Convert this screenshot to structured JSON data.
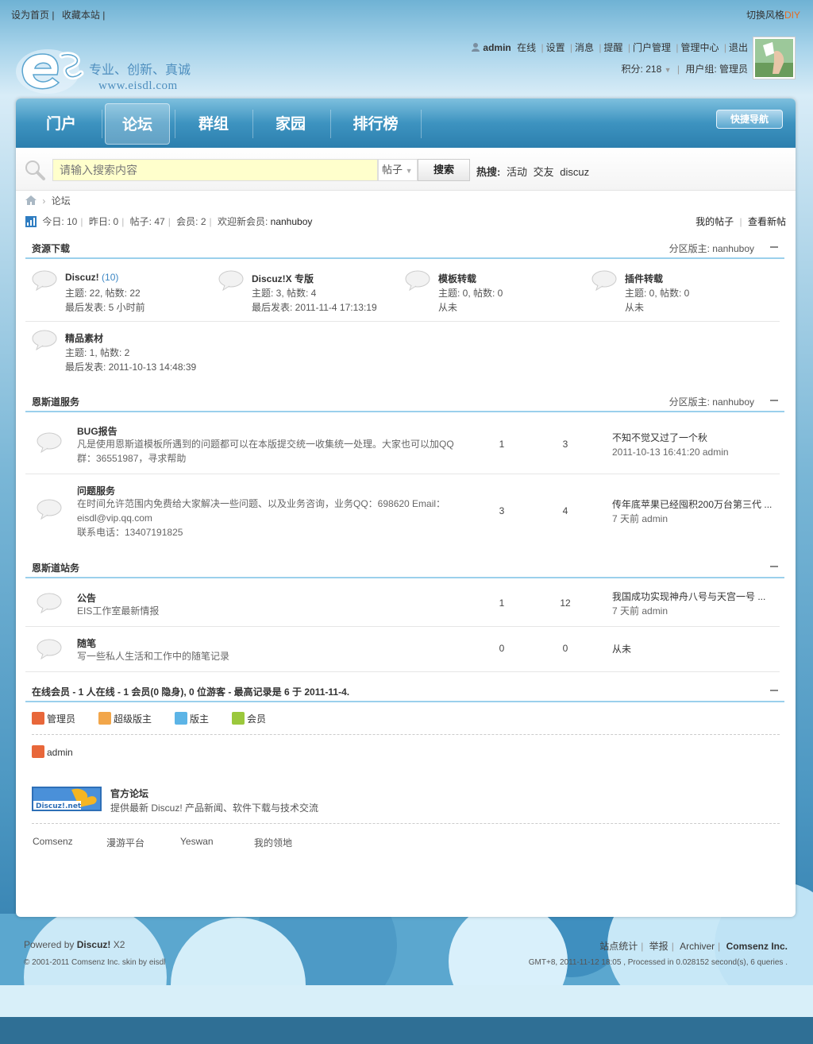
{
  "topbar": {
    "set_home": "设为首页",
    "bookmark": "收藏本站",
    "sep": "|",
    "switch_style": "切换风格",
    "diy": "DIY"
  },
  "header": {
    "slogan": "专业、创新、真诚",
    "url": "www.eisdl.com",
    "user": {
      "name": "admin",
      "status": "在线",
      "links": [
        "设置",
        "消息",
        "提醒",
        "门户管理",
        "管理中心",
        "退出"
      ]
    },
    "credits_label": "积分: 218",
    "usergroup_label": "用户组: 管理员"
  },
  "nav": {
    "items": [
      "门户",
      "论坛",
      "群组",
      "家园",
      "排行榜"
    ],
    "active": "论坛",
    "quick_nav": "快捷导航"
  },
  "search": {
    "placeholder": "请输入搜索内容",
    "type": "帖子",
    "button": "搜索",
    "hot_label": "热搜:",
    "hot_terms": [
      "活动",
      "交友",
      "discuz"
    ]
  },
  "breadcrumb": {
    "current": "论坛"
  },
  "stats": {
    "today": "今日: 10",
    "yesterday": "昨日: 0",
    "posts": "帖子: 47",
    "members": "会员: 2",
    "welcome": "欢迎新会员:",
    "newest": "nanhuboy",
    "my_posts": "我的帖子",
    "new_posts": "查看新帖"
  },
  "sections": [
    {
      "title": "资源下载",
      "moderator_label": "分区版主:",
      "moderator": "nanhuboy",
      "forums": [
        {
          "name": "Discuz!",
          "count": "(10)",
          "line1": "主题: 22, 帖数: 22",
          "line2": "最后发表: 5 小时前"
        },
        {
          "name": "Discuz!X 专版",
          "line1": "主题: 3, 帖数: 4",
          "line2": "最后发表: 2011-11-4 17:13:19"
        },
        {
          "name": "模板转载",
          "line1": "主题: 0, 帖数: 0",
          "line2": "从未"
        },
        {
          "name": "插件转载",
          "line1": "主题: 0, 帖数: 0",
          "line2": "从未"
        },
        {
          "name": "精品素材",
          "line1": "主题: 1, 帖数: 2",
          "line2": "最后发表: 2011-10-13 14:48:39"
        }
      ]
    },
    {
      "title": "恩斯道服务",
      "moderator_label": "分区版主:",
      "moderator": "nanhuboy",
      "forums": [
        {
          "name": "BUG报告",
          "desc1": "凡是使用恩斯道模板所遇到的问题都可以在本版提交统一收集统一处理。大家也可以加QQ",
          "desc2": "群：36551987，寻求帮助",
          "threads": "1",
          "posts": "3",
          "last_title": "不知不觉又过了一个秋",
          "last_meta": "2011-10-13 16:41:20 admin"
        },
        {
          "name": "问题服务",
          "desc1": "在时间允许范围内免费给大家解决一些问题、以及业务咨询，业务QQ：698620 Email：",
          "desc2": "eisdl@vip.qq.com",
          "desc3": "联系电话：13407191825",
          "threads": "3",
          "posts": "4",
          "last_title": "传年底苹果已经囤积200万台第三代 ...",
          "last_meta": "7 天前 admin"
        }
      ]
    },
    {
      "title": "恩斯道站务",
      "forums": [
        {
          "name": "公告",
          "desc1": "EIS工作室最新情报",
          "threads": "1",
          "posts": "12",
          "last_title": "我国成功实现神舟八号与天宫一号 ...",
          "last_meta": "7 天前 admin"
        },
        {
          "name": "随笔",
          "desc1": "写一些私人生活和工作中的随笔记录",
          "threads": "0",
          "posts": "0",
          "last_title": "从未"
        }
      ]
    }
  ],
  "online": {
    "title": "在线会员 - 1 人在线 - 1 会员(0 隐身), 0 位游客 - 最高记录是 6 于 2011-11-4.",
    "legend": [
      "管理员",
      "超级版主",
      "版主",
      "会员"
    ],
    "users": [
      "admin"
    ]
  },
  "friendlinks": {
    "logo_text": "Discuz!.net",
    "name": "官方论坛",
    "desc": "提供最新 Discuz! 产品新闻、软件下载与技术交流",
    "text_links": [
      "Comsenz",
      "漫游平台",
      "Yeswan",
      "我的领地"
    ]
  },
  "footer": {
    "powered": "Powered by",
    "product": "Discuz!",
    "version": "X2",
    "copyright": "© 2001-2011 Comsenz Inc.  skin by eisdl",
    "links": [
      "站点统计",
      "举报",
      "Archiver"
    ],
    "company": "Comsenz Inc.",
    "info": "GMT+8, 2011-11-12 18:05 , Processed in 0.028152 second(s), 6 queries ."
  },
  "colors": {
    "nav": "#3d93c0",
    "accent": "#3b86c4",
    "search_bg": "#ffffcc",
    "diy": "#e86a1d"
  }
}
